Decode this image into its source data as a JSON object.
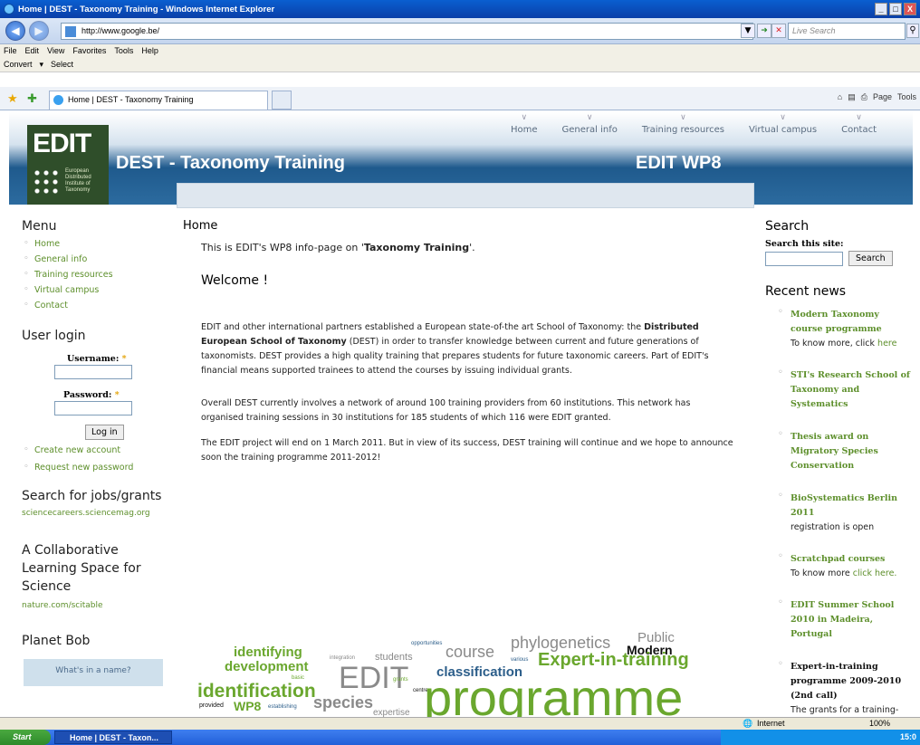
{
  "window": {
    "title": "Home | DEST - Taxonomy Training - Windows Internet Explorer",
    "min": "_",
    "max": "□",
    "close": "X"
  },
  "address": {
    "url": "http://www.google.be/",
    "search_placeholder": "Live Search"
  },
  "menubar": [
    "File",
    "Edit",
    "View",
    "Favorites",
    "Tools",
    "Help"
  ],
  "toolbar2": {
    "convert": "Convert",
    "select": "Select"
  },
  "tab": {
    "title": "Home | DEST - Taxonomy Training"
  },
  "tools": {
    "page": "Page",
    "tools": "Tools"
  },
  "site": {
    "name": "DEST - Taxonomy Training",
    "wp": "EDIT WP8",
    "logo": {
      "text": "EDIT",
      "sub": [
        "European",
        "Distributed",
        "Institute of",
        "Taxonomy"
      ]
    },
    "nav": [
      "Home",
      "General info",
      "Training resources",
      "Virtual campus",
      "Contact"
    ]
  },
  "left": {
    "menu_title": "Menu",
    "menu": [
      "Home",
      "General info",
      "Training resources",
      "Virtual campus",
      "Contact"
    ],
    "login_title": "User login",
    "username_label": "Username:",
    "password_label": "Password:",
    "required": "*",
    "login_button": "Log in",
    "create_account": "Create new account",
    "request_password": "Request new password",
    "jobs_title": "Search for jobs/grants",
    "jobs_link": "sciencecareers.sciencemag.org",
    "collab_title": "A Collaborative Learning Space for Science",
    "collab_link": "nature.com/scitable",
    "planet_title": "Planet Bob",
    "planet_box": "What's in a name?"
  },
  "main": {
    "heading": "Home",
    "intro_pre": "This is EDIT's WP8 info-page on '",
    "intro_bold": "Taxonomy Training",
    "intro_post": "'.",
    "welcome": "Welcome !",
    "p1a": "EDIT and other international partners established a European state-of-the art School of Taxonomy: the ",
    "p1bold": "Distributed European School of Taxonomy",
    "p1b": " (DEST) in order to transfer knowledge between current and future generations of taxonomists. DEST provides a high quality training that prepares students for future taxonomic careers. Part of EDIT's financial means supported trainees to attend the courses by issuing individual grants.",
    "p2": "Overall DEST currently involves a network of around 100 training providers from 60 institutions. This network has organised training sessions in 30 institutions for 185 students of which 116 were EDIT granted.",
    "p3": "The EDIT project will end on 1 March 2011. But in view of its success, DEST training will continue and we hope to announce soon the training programme 2011-2012!",
    "cloud": {
      "public": "Public",
      "opportunities": "opportunities",
      "identifying": "identifying",
      "integration": "integration",
      "students": "students",
      "course": "course",
      "phylogenetics": "phylogenetics",
      "modern": "Modern",
      "development": "development",
      "various": "various",
      "expert": "Expert-in-training",
      "basic": "basic",
      "edit": "EDIT",
      "grants": "grants",
      "classification": "classification",
      "identification": "identification",
      "centre": "centre",
      "programme": "programme",
      "provided": "provided",
      "wp8": "WP8",
      "establishing": "establishing",
      "species": "species",
      "expertise": "expertise"
    }
  },
  "right": {
    "search_title": "Search",
    "search_label": "Search this site:",
    "search_button": "Search",
    "news_title": "Recent news",
    "news": [
      {
        "title": "Modern Taxonomy course programme",
        "desc": "To know more, click ",
        "link": "here"
      },
      {
        "title": "STI's Research School of Taxonomy and Systematics",
        "desc": "",
        "link": ""
      },
      {
        "title": "Thesis award on Migratory Species Conservation",
        "desc": "",
        "link": ""
      },
      {
        "title": "BioSystematics Berlin 2011",
        "desc": "registration is open",
        "link": ""
      },
      {
        "title": "Scratchpad courses",
        "desc": "To know more ",
        "link": "click here."
      },
      {
        "title": "EDIT Summer School 2010 in Madeira, Portugal",
        "desc": "",
        "link": ""
      },
      {
        "title": "Expert-in-training programme 2009-2010 (2nd call)",
        "desc": "The grants for a training-",
        "link": ""
      }
    ]
  },
  "statusbar": {
    "zone": "Internet",
    "zoom": "100%"
  },
  "taskbar": {
    "start": "Start",
    "item": "Home | DEST - Taxon...",
    "clock": "15:0"
  }
}
